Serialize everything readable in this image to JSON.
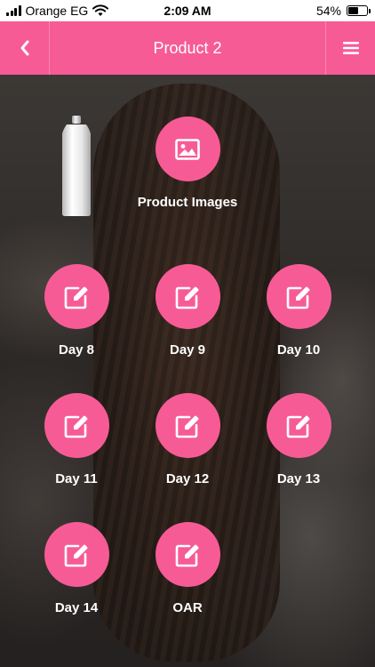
{
  "status_bar": {
    "carrier": "Orange EG",
    "time": "2:09 AM",
    "battery_percent": "54%",
    "battery_level": 0.54
  },
  "nav": {
    "title": "Product 2",
    "back_icon": "chevron-left-icon",
    "menu_icon": "hamburger-menu-icon"
  },
  "colors": {
    "accent": "#f75b95",
    "label": "#ffffff"
  },
  "product_images": {
    "label": "Product Images",
    "icon": "image-icon"
  },
  "days": [
    {
      "label": "Day 8",
      "icon": "edit-icon"
    },
    {
      "label": "Day 9",
      "icon": "edit-icon"
    },
    {
      "label": "Day 10",
      "icon": "edit-icon"
    },
    {
      "label": "Day 11",
      "icon": "edit-icon"
    },
    {
      "label": "Day 12",
      "icon": "edit-icon"
    },
    {
      "label": "Day 13",
      "icon": "edit-icon"
    },
    {
      "label": "Day 14",
      "icon": "edit-icon"
    },
    {
      "label": "OAR",
      "icon": "edit-icon"
    }
  ]
}
